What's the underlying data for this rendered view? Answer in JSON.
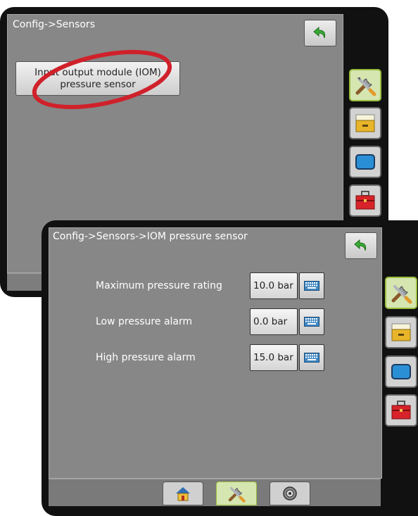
{
  "back_screen": {
    "title": "Config->Sensors",
    "sensor_button": {
      "line1": "Input output module (IOM)",
      "line2": "pressure sensor"
    }
  },
  "front_screen": {
    "title": "Config->Sensors->IOM pressure sensor",
    "rows": [
      {
        "label": "Maximum pressure rating",
        "value": "10.0 bar"
      },
      {
        "label": "Low pressure alarm",
        "value": "0.0 bar"
      },
      {
        "label": "High pressure alarm",
        "value": "15.0 bar"
      }
    ]
  },
  "side_tabs": [
    {
      "icon": "tools-icon",
      "active": true
    },
    {
      "icon": "file-cabinet-icon",
      "active": false
    },
    {
      "icon": "display-icon",
      "active": false
    },
    {
      "icon": "toolbox-icon",
      "active": false
    }
  ],
  "bottom_tabs": [
    {
      "icon": "home-icon",
      "active": false
    },
    {
      "icon": "tools-icon",
      "active": true
    },
    {
      "icon": "gps-icon",
      "active": false
    }
  ],
  "colors": {
    "panel_gray": "#878787",
    "back_arrow_green": "#3aaa35",
    "active_tab": "#d5e6b0",
    "highlight_circle": "#d0212b"
  }
}
